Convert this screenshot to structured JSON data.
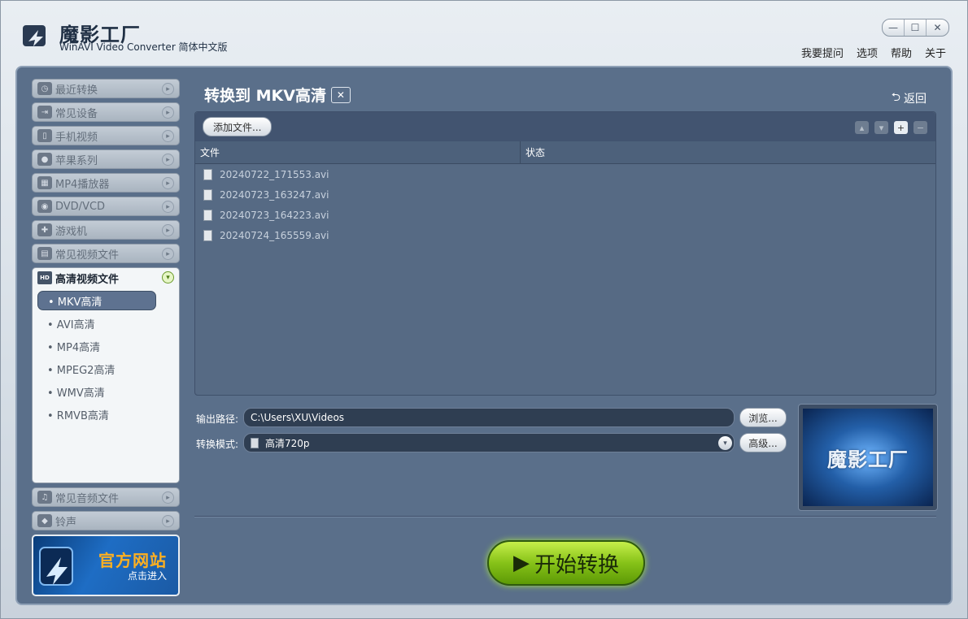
{
  "app": {
    "title": "魔影工厂",
    "subtitle": "WinAVI Video Converter 简体中文版"
  },
  "window_controls": [
    "—",
    "☐",
    "✕"
  ],
  "top_menu": [
    "我要提问",
    "选项",
    "帮助",
    "关于"
  ],
  "sidebar": {
    "categories": [
      {
        "label": "最近转换",
        "icon": "clock-icon"
      },
      {
        "label": "常见设备",
        "icon": "device-icon"
      },
      {
        "label": "手机视频",
        "icon": "phone-icon"
      },
      {
        "label": "苹果系列",
        "icon": "apple-icon"
      },
      {
        "label": "MP4播放器",
        "icon": "mp4-player-icon"
      },
      {
        "label": "DVD/VCD",
        "icon": "disc-icon"
      },
      {
        "label": "游戏机",
        "icon": "gamepad-icon"
      },
      {
        "label": "常见视频文件",
        "icon": "film-icon"
      }
    ],
    "open_category": {
      "label": "高清视频文件",
      "icon_text": "HD",
      "items": [
        "• MKV高清",
        "• AVI高清",
        "• MP4高清",
        "• MPEG2高清",
        "• WMV高清",
        "• RMVB高清"
      ],
      "selected": "• MKV高清"
    },
    "bottom_categories": [
      {
        "label": "常见音频文件",
        "icon": "music-icon"
      },
      {
        "label": "铃声",
        "icon": "ringtone-icon"
      }
    ],
    "banner": {
      "title": "官方网站",
      "subtitle": "点击进入"
    }
  },
  "content": {
    "title": "转换到 MKV高清",
    "back_label": "返回",
    "add_file_label": "添加文件...",
    "columns": [
      "文件",
      "状态"
    ],
    "files": [
      {
        "name": "20240722_171553.avi",
        "status": ""
      },
      {
        "name": "20240723_163247.avi",
        "status": ""
      },
      {
        "name": "20240723_164223.avi",
        "status": ""
      },
      {
        "name": "20240724_165559.avi",
        "status": ""
      }
    ],
    "output_path_label": "输出路径:",
    "output_path_value": "C:\\Users\\XU\\Videos",
    "browse_label": "浏览...",
    "mode_label": "转换模式:",
    "mode_value": "高清720p",
    "advanced_label": "高级...",
    "preview_text": "魔影工厂",
    "start_label": "开始转换"
  },
  "colors": {
    "frame": "#5a6f8a",
    "start_button": "#86c218",
    "banner_title": "#ffb020"
  }
}
